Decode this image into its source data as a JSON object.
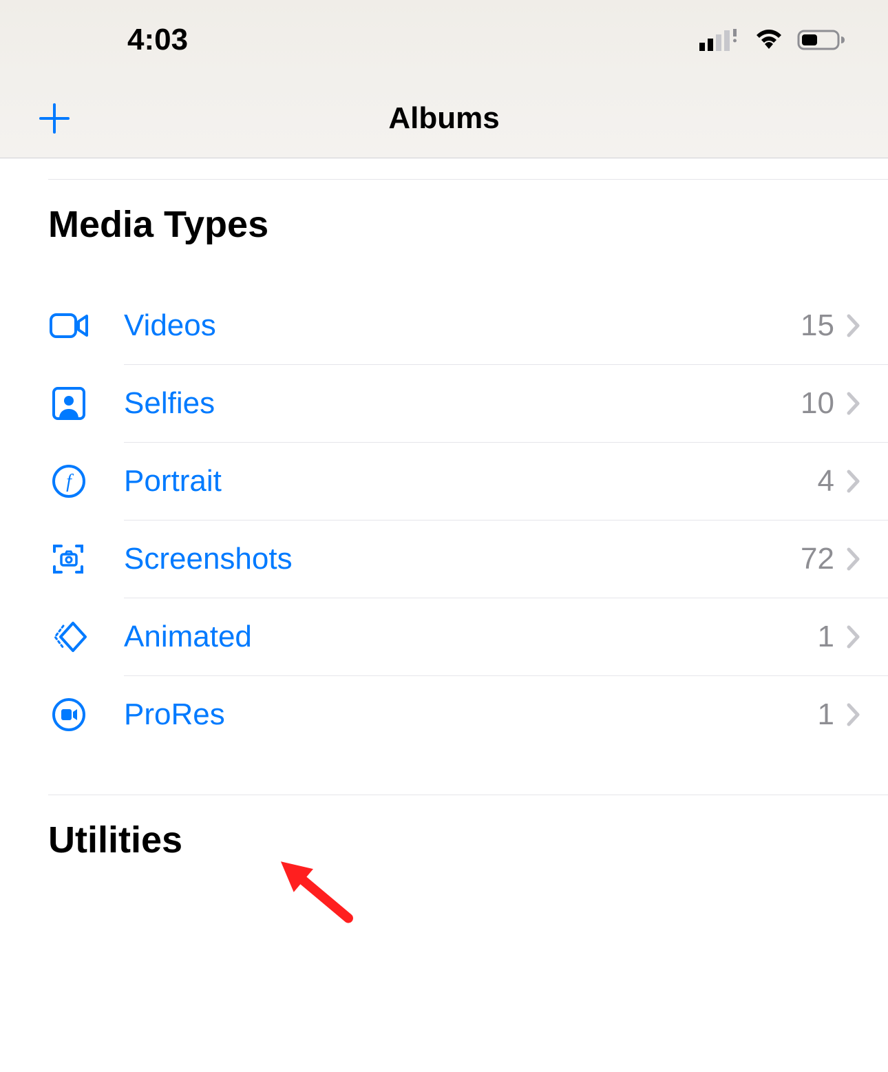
{
  "status_bar": {
    "time": "4:03"
  },
  "nav": {
    "title": "Albums"
  },
  "sections": {
    "media_types": {
      "title": "Media Types",
      "rows": [
        {
          "label": "Videos",
          "count": "15"
        },
        {
          "label": "Selfies",
          "count": "10"
        },
        {
          "label": "Portrait",
          "count": "4"
        },
        {
          "label": "Screenshots",
          "count": "72"
        },
        {
          "label": "Animated",
          "count": "1"
        },
        {
          "label": "ProRes",
          "count": "1"
        }
      ]
    },
    "utilities": {
      "title": "Utilities"
    }
  }
}
